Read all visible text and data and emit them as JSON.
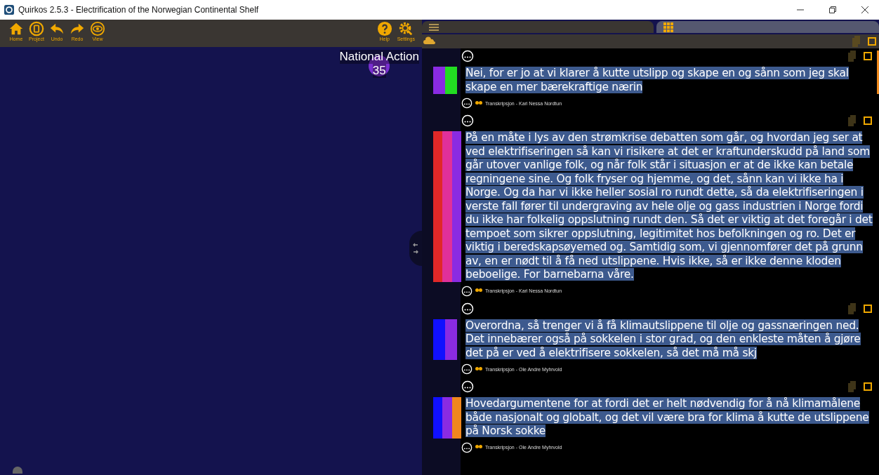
{
  "window": {
    "title": "Quirkos 2.5.3 - Electrification of the Norwegian Continental Shelf"
  },
  "toolbar": {
    "left": [
      {
        "label": "Home",
        "kind": "home"
      },
      {
        "label": "Project",
        "kind": "project"
      },
      {
        "label": "Undo",
        "kind": "undo"
      },
      {
        "label": "Redo",
        "kind": "redo"
      },
      {
        "label": "View",
        "kind": "view"
      }
    ],
    "right": [
      {
        "label": "Help",
        "kind": "help"
      },
      {
        "label": "Settings",
        "kind": "settings"
      }
    ]
  },
  "canvas": {
    "node": {
      "label": "National Action",
      "count": "35",
      "color": "#7a2fd0"
    }
  },
  "tabs": [
    {
      "kind": "list",
      "selected": true
    },
    {
      "kind": "grid",
      "selected": false
    }
  ],
  "quotes": [
    {
      "stripes": [
        {
          "color": "#8a2be2"
        },
        {
          "color": "#22dd22"
        }
      ],
      "text": "Nei, for er jo at vi klarer å kutte utslipp og skape en og sånn som jeg skal skape en mer bærekraftige nærin",
      "source": "Transkripsjon - Kari Nessa Nordtun"
    },
    {
      "stripes": [
        {
          "color": "#e02828"
        },
        {
          "color": "#e0309a"
        },
        {
          "color": "#8a2be2"
        }
      ],
      "text": " På en måte i lys av den strømkrise debatten som går, og hvordan jeg ser at ved elektrifiseringen så kan vi risikere at det er kraftunderskudd på land som går utover vanlige folk, og når folk står i situasjon er at de ikke kan betale regningene sine. Og folk fryser og hjemme, og det, sånn kan vi ikke ha i Norge. Og da har vi ikke heller sosial ro rundt dette, så da elektrifiseringen i verste fall fører til undergraving av hele olje og gass industrien i Norge fordi du ikke har folkelig oppslutning rundt den. Så det er viktig at det foregår i det tempoet som sikrer oppslutning, legitimitet hos befolkningen og ro. Det er viktig i beredskapsøyemed og. Samtidig som, vi gjennomfører det på grunn av, en er nødt til å få ned utslippene. Hvis ikke, så er ikke denne kloden beboelige. For barnebarna våre.",
      "source": "Transkripsjon - Kari Nessa Nordtun"
    },
    {
      "stripes": [
        {
          "color": "#1010ff"
        },
        {
          "color": "#8a2be2"
        }
      ],
      "text": "Overordna, så trenger vi å få klimautslippene til olje og gassnæringen ned. Det innebærer også på sokkelen i stor grad, og den enkleste måten å gjøre det på er ved å elektrifisere sokkelen, så det må må skj",
      "source": "Transkripsjon - Ole Andre Myhrvold"
    },
    {
      "stripes": [
        {
          "color": "#1010ff"
        },
        {
          "color": "#8a2be2"
        },
        {
          "color": "#f0861e"
        }
      ],
      "text": "Hovedargumentene for at fordi det er helt nødvendig for å nå klimamålene både nasjonalt og globalt, og det vil være bra for klima å kutte de utslippene på Norsk sokke",
      "source": "Transkripsjon - Ole Andre Myhrvold"
    }
  ]
}
